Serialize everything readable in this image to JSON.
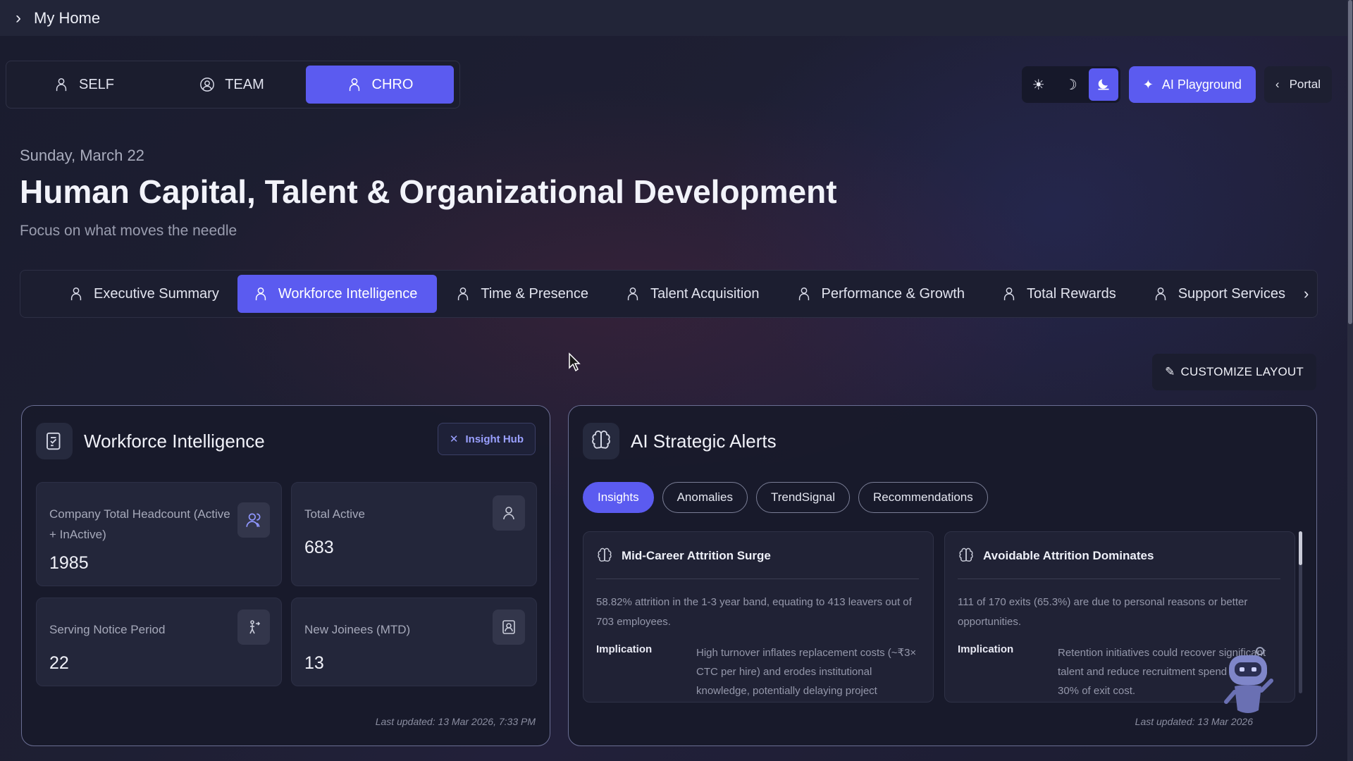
{
  "topbar": {
    "title": "My Home"
  },
  "roles": [
    {
      "label": "SELF",
      "active": false
    },
    {
      "label": "TEAM",
      "active": false
    },
    {
      "label": "CHRO",
      "active": true
    }
  ],
  "controls": {
    "ai_playground": "AI Playground",
    "portal": "Portal",
    "theme_active": "dusk"
  },
  "header": {
    "date": "Sunday, March 22",
    "title": "Human Capital, Talent & Organizational Development",
    "subtitle": "Focus on what moves the needle"
  },
  "tabs": [
    {
      "label": "Executive Summary",
      "active": false
    },
    {
      "label": "Workforce Intelligence",
      "active": true
    },
    {
      "label": "Time & Presence",
      "active": false
    },
    {
      "label": "Talent Acquisition",
      "active": false
    },
    {
      "label": "Performance & Growth",
      "active": false
    },
    {
      "label": "Total Rewards",
      "active": false
    },
    {
      "label": "Support Services",
      "active": false
    }
  ],
  "customize_label": "CUSTOMIZE LAYOUT",
  "workforce": {
    "title": "Workforce Intelligence",
    "insight_hub": "Insight Hub",
    "cards": [
      {
        "label": "Company Total Headcount (Active + InActive)",
        "value": "1985",
        "icon": "people-icon"
      },
      {
        "label": "Total Active",
        "value": "683",
        "icon": "person-icon"
      },
      {
        "label": "Serving Notice Period",
        "value": "22",
        "icon": "exit-icon"
      },
      {
        "label": "New Joinees (MTD)",
        "value": "13",
        "icon": "new-joinee-icon"
      }
    ],
    "updated": "Last updated: 13 Mar 2026, 7:33 PM"
  },
  "alerts": {
    "title": "AI Strategic Alerts",
    "pills": [
      {
        "label": "Insights",
        "active": true
      },
      {
        "label": "Anomalies",
        "active": false
      },
      {
        "label": "TrendSignal",
        "active": false
      },
      {
        "label": "Recommendations",
        "active": false
      }
    ],
    "items": [
      {
        "title": "Mid-Career Attrition Surge",
        "body": "58.82% attrition in the 1-3 year band, equating to 413 leavers out of 703 employees.",
        "implication_label": "Implication",
        "implication": "High turnover inflates replacement costs (~₹3× CTC per hire) and erodes institutional knowledge, potentially delaying project"
      },
      {
        "title": "Avoidable Attrition Dominates",
        "body": "111 of 170 exits (65.3%) are due to personal reasons or better opportunities.",
        "implication_label": "Implication",
        "implication": "Retention initiatives could recover significant talent and reduce recruitment spend by up to 30% of exit cost."
      }
    ],
    "updated": "Last updated: 13 Mar 2026"
  },
  "colors": {
    "accent": "#5b5bf0",
    "background": "#1e1f33"
  }
}
